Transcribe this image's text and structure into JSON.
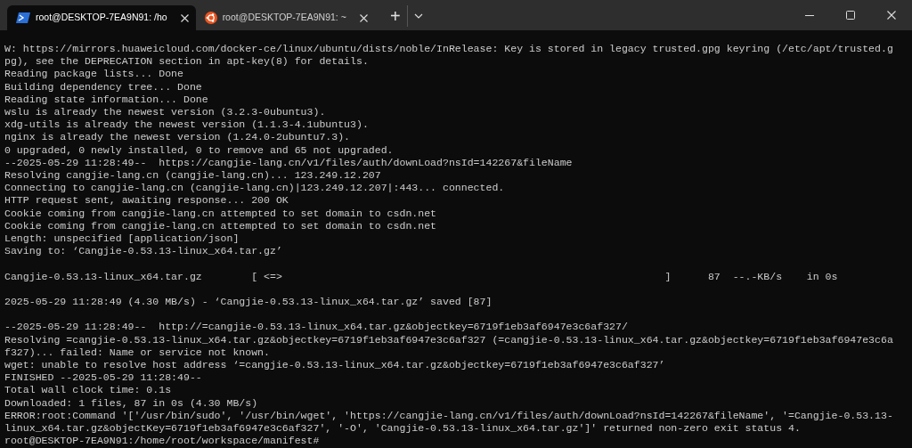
{
  "tabs": [
    {
      "kind": "powershell",
      "title": "root@DESKTOP-7EA9N91: /ho",
      "selected": true
    },
    {
      "kind": "ubuntu",
      "title": "root@DESKTOP-7EA9N91: ~",
      "selected": false
    }
  ],
  "new_tab": "+",
  "output_blocks": [
    [
      "W: https://mirrors.huaweicloud.com/docker-ce/linux/ubuntu/dists/noble/InRelease: Key is stored in legacy trusted.gpg keyring (/etc/apt/trusted.g",
      "pg), see the DEPRECATION section in apt-key(8) for details.",
      "Reading package lists... Done",
      "Building dependency tree... Done",
      "Reading state information... Done",
      "wslu is already the newest version (3.2.3-0ubuntu3).",
      "xdg-utils is already the newest version (1.1.3-4.1ubuntu3).",
      "nginx is already the newest version (1.24.0-2ubuntu7.3).",
      "0 upgraded, 0 newly installed, 0 to remove and 65 not upgraded.",
      "--2025-05-29 11:28:49--  https://cangjie-lang.cn/v1/files/auth/downLoad?nsId=142267&fileName",
      "Resolving cangjie-lang.cn (cangjie-lang.cn)... 123.249.12.207",
      "Connecting to cangjie-lang.cn (cangjie-lang.cn)|123.249.12.207|:443... connected.",
      "HTTP request sent, awaiting response... 200 OK",
      "Cookie coming from cangjie-lang.cn attempted to set domain to csdn.net",
      "Cookie coming from cangjie-lang.cn attempted to set domain to csdn.net",
      "Length: unspecified [application/json]",
      "Saving to: ‘Cangjie-0.53.13-linux_x64.tar.gz’"
    ],
    [
      "Cangjie-0.53.13-linux_x64.tar.gz        [ <=>                                                              ]      87  --.-KB/s    in 0s"
    ],
    [
      "2025-05-29 11:28:49 (4.30 MB/s) - ‘Cangjie-0.53.13-linux_x64.tar.gz’ saved [87]"
    ],
    [
      "--2025-05-29 11:28:49--  http://=cangjie-0.53.13-linux_x64.tar.gz&objectkey=6719f1eb3af6947e3c6af327/",
      "Resolving =cangjie-0.53.13-linux_x64.tar.gz&objectkey=6719f1eb3af6947e3c6af327 (=cangjie-0.53.13-linux_x64.tar.gz&objectkey=6719f1eb3af6947e3c6a",
      "f327)... failed: Name or service not known.",
      "wget: unable to resolve host address ‘=cangjie-0.53.13-linux_x64.tar.gz&objectkey=6719f1eb3af6947e3c6af327’",
      "FINISHED --2025-05-29 11:28:49--",
      "Total wall clock time: 0.1s",
      "Downloaded: 1 files, 87 in 0s (4.30 MB/s)",
      "ERROR:root:Command '['/usr/bin/sudo', '/usr/bin/wget', 'https://cangjie-lang.cn/v1/files/auth/downLoad?nsId=142267&fileName', '=Cangjie-0.53.13-",
      "linux_x64.tar.gz&objectKey=6719f1eb3af6947e3c6af327', '-O', 'Cangjie-0.53.13-linux_x64.tar.gz']' returned non-zero exit status 4.",
      "root@DESKTOP-7EA9N91:/home/root/workspace/manifest#"
    ]
  ]
}
